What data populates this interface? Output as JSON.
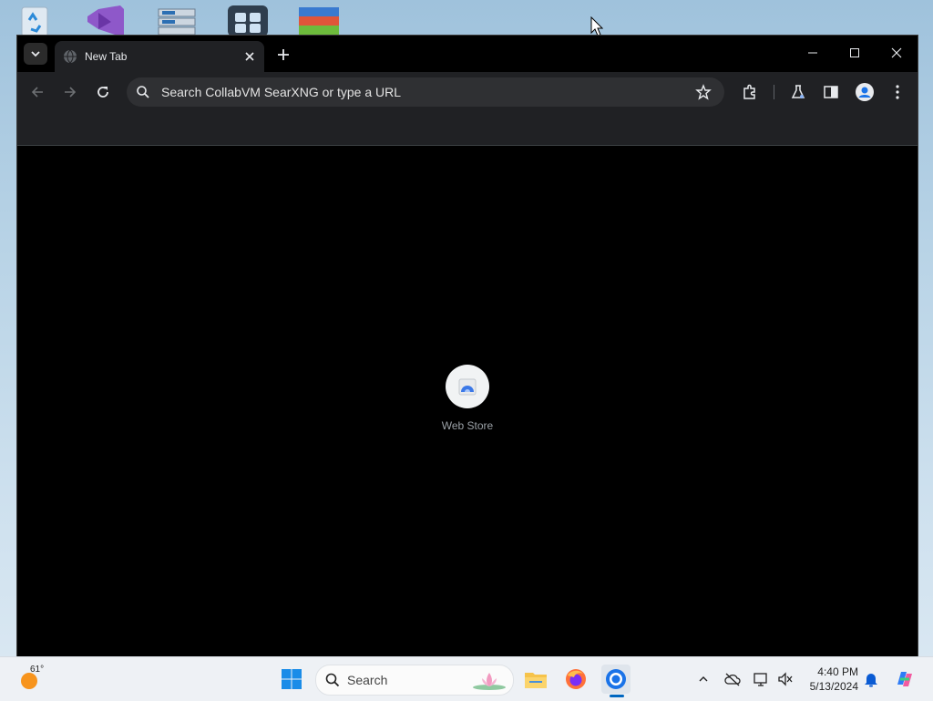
{
  "browser": {
    "tab": {
      "title": "New Tab"
    },
    "omnibox": {
      "placeholder": "Search CollabVM SearXNG or type a URL"
    },
    "shortcut": {
      "label": "Web Store"
    }
  },
  "taskbar": {
    "weather_temp": "61°",
    "search_label": "Search",
    "time": "4:40 PM",
    "date": "5/13/2024"
  },
  "icons": {
    "tab_search": "chevron-down-icon",
    "favicon": "globe-icon",
    "tab_close": "close-icon",
    "new_tab": "plus-icon",
    "back": "arrow-left-icon",
    "forward": "arrow-right-icon",
    "reload": "reload-icon",
    "bookmark": "star-icon",
    "extensions": "puzzle-icon",
    "labs": "flask-icon",
    "side_panel": "side-panel-icon",
    "profile": "avatar-icon",
    "menu": "kebab-menu-icon"
  },
  "colors": {
    "tab_bg": "#202124",
    "toolbar_bg": "#202124",
    "omnibox_bg": "#2f3033",
    "page_bg": "#000000",
    "accent": "#0067c0"
  }
}
